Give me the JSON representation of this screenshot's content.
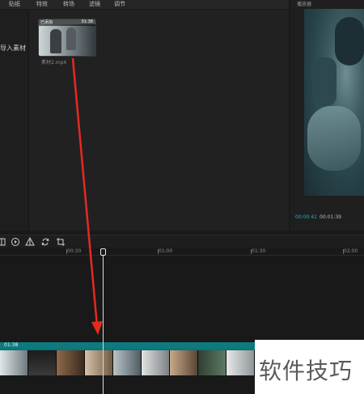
{
  "tabs": [
    {
      "label": "贴纸"
    },
    {
      "label": "特效"
    },
    {
      "label": "转场"
    },
    {
      "label": "滤镜"
    },
    {
      "label": "调节"
    }
  ],
  "media": {
    "import_label": "导入素材",
    "clip": {
      "badge": "已添加",
      "duration": "01:38",
      "filename": "素材2.mp4"
    }
  },
  "player": {
    "title": "播放器",
    "time_current": "00:00:41",
    "time_total": "00:01:39"
  },
  "toolbar": {
    "icons": [
      "freeze-icon",
      "reverse-icon",
      "mirror-icon",
      "rotate-icon",
      "crop-icon"
    ]
  },
  "timeline": {
    "ruler_labels": [
      "00:30",
      "01:00",
      "01:30",
      "02:00"
    ],
    "track_duration": "01:38"
  },
  "watermark": {
    "text": "软件技巧"
  },
  "colors": {
    "accent": "#26b2c2",
    "track": "#0e7276",
    "arrow": "#e52a1f"
  }
}
